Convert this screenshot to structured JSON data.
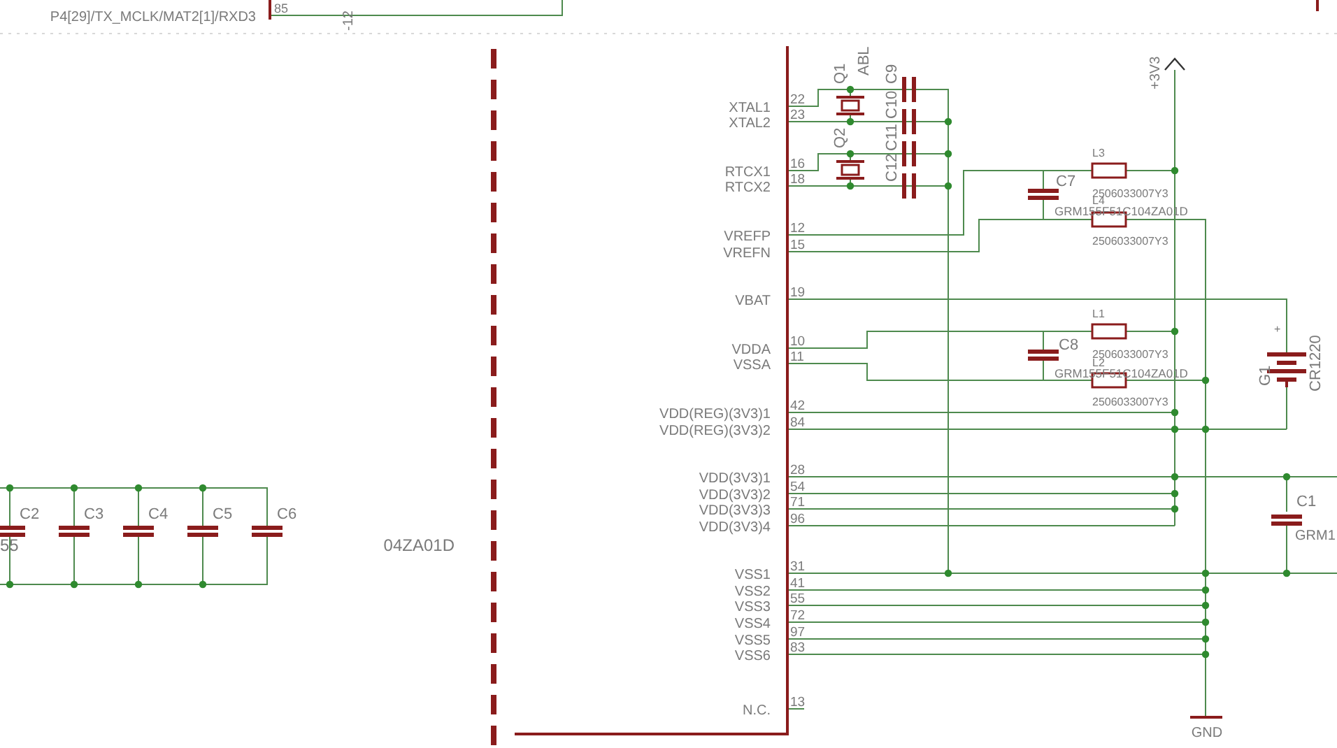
{
  "header_fragment": {
    "pin_name": "P4[29]/TX_MCLK/MAT2[1]/RXD3",
    "pin_number": "85",
    "rotated_label": "-12"
  },
  "chip": {
    "pins": [
      {
        "name": "XTAL1",
        "number": "22"
      },
      {
        "name": "XTAL2",
        "number": "23"
      },
      {
        "name": "RTCX1",
        "number": "16"
      },
      {
        "name": "RTCX2",
        "number": "18"
      },
      {
        "name": "VREFP",
        "number": "12"
      },
      {
        "name": "VREFN",
        "number": "15"
      },
      {
        "name": "VBAT",
        "number": "19"
      },
      {
        "name": "VDDA",
        "number": "10"
      },
      {
        "name": "VSSA",
        "number": "11"
      },
      {
        "name": "VDD(REG)(3V3)1",
        "number": "42"
      },
      {
        "name": "VDD(REG)(3V3)2",
        "number": "84"
      },
      {
        "name": "VDD(3V3)1",
        "number": "28"
      },
      {
        "name": "VDD(3V3)2",
        "number": "54"
      },
      {
        "name": "VDD(3V3)3",
        "number": "71"
      },
      {
        "name": "VDD(3V3)4",
        "number": "96"
      },
      {
        "name": "VSS1",
        "number": "31"
      },
      {
        "name": "VSS2",
        "number": "41"
      },
      {
        "name": "VSS3",
        "number": "55"
      },
      {
        "name": "VSS4",
        "number": "72"
      },
      {
        "name": "VSS5",
        "number": "97"
      },
      {
        "name": "VSS6",
        "number": "83"
      },
      {
        "name": "N.C.",
        "number": "13"
      }
    ]
  },
  "crystals": [
    {
      "name": "Q1",
      "value": "ABL"
    },
    {
      "name": "Q2"
    }
  ],
  "crystal_caps": [
    "C9",
    "C10",
    "C11",
    "C12"
  ],
  "power": {
    "supply": "+3V3",
    "ground": "GND"
  },
  "inductors": [
    {
      "name": "L3",
      "value": "2506033007Y3"
    },
    {
      "name": "L4",
      "value": "2506033007Y3"
    },
    {
      "name": "L1",
      "value": "2506033007Y3"
    },
    {
      "name": "L2",
      "value": "2506033007Y3"
    }
  ],
  "filter_caps": [
    {
      "name": "C7",
      "value": "GRM155F51C104ZA01D"
    },
    {
      "name": "C8",
      "value": "GRM155F51C104ZA01D"
    }
  ],
  "battery": {
    "name": "G1",
    "value": "CR1220",
    "polarity": "+"
  },
  "decoupling_cap": {
    "name": "C1",
    "value": "GRM1"
  },
  "cap_bank": [
    {
      "name": "C2",
      "value": "55"
    },
    {
      "name": "C3"
    },
    {
      "name": "C4"
    },
    {
      "name": "C5"
    },
    {
      "name": "C6",
      "value": "04ZA01D"
    }
  ]
}
